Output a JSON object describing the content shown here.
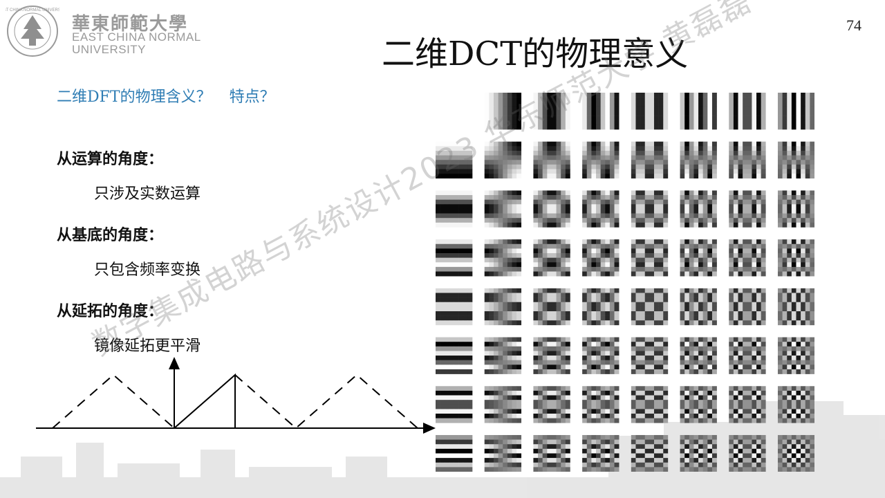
{
  "logo": {
    "name_cn": "華東師範大學",
    "name_en_line1": "EAST CHINA NORMAL",
    "name_en_line2": "UNIVERSITY"
  },
  "page_number": "74",
  "title": "二维DCT的物理意义",
  "question": {
    "part1": "二维DFT的物理含义？",
    "part2": "特点？"
  },
  "sections": [
    {
      "heading": "从运算的角度：",
      "text": "只涉及实数运算"
    },
    {
      "heading": "从基底的角度：",
      "text": "只包含频率变换"
    },
    {
      "heading": "从延拓的角度：",
      "text": "镜像延拓更平滑"
    }
  ],
  "watermark": "数字集成电路与系统设计2023 华东师范大学 黄磊磊",
  "colors": {
    "question": "#2f7db4",
    "text": "#111111",
    "logo_gray": "#9a9a9a"
  },
  "figure": {
    "type": "DCT basis images",
    "grid_rows": 8,
    "grid_cols": 8,
    "block_size": 8
  }
}
